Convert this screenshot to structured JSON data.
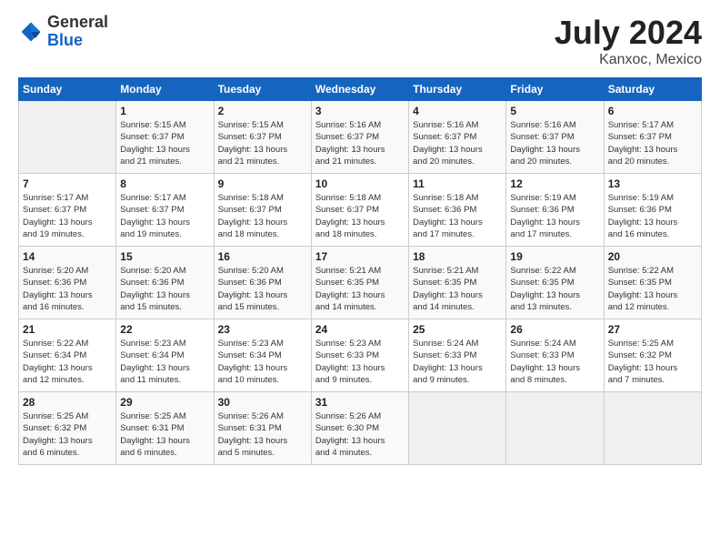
{
  "header": {
    "logo_general": "General",
    "logo_blue": "Blue",
    "title": "July 2024",
    "location": "Kanxoc, Mexico"
  },
  "calendar": {
    "days_of_week": [
      "Sunday",
      "Monday",
      "Tuesday",
      "Wednesday",
      "Thursday",
      "Friday",
      "Saturday"
    ],
    "weeks": [
      [
        {
          "day": "",
          "info": ""
        },
        {
          "day": "1",
          "info": "Sunrise: 5:15 AM\nSunset: 6:37 PM\nDaylight: 13 hours\nand 21 minutes."
        },
        {
          "day": "2",
          "info": "Sunrise: 5:15 AM\nSunset: 6:37 PM\nDaylight: 13 hours\nand 21 minutes."
        },
        {
          "day": "3",
          "info": "Sunrise: 5:16 AM\nSunset: 6:37 PM\nDaylight: 13 hours\nand 21 minutes."
        },
        {
          "day": "4",
          "info": "Sunrise: 5:16 AM\nSunset: 6:37 PM\nDaylight: 13 hours\nand 20 minutes."
        },
        {
          "day": "5",
          "info": "Sunrise: 5:16 AM\nSunset: 6:37 PM\nDaylight: 13 hours\nand 20 minutes."
        },
        {
          "day": "6",
          "info": "Sunrise: 5:17 AM\nSunset: 6:37 PM\nDaylight: 13 hours\nand 20 minutes."
        }
      ],
      [
        {
          "day": "7",
          "info": "Sunrise: 5:17 AM\nSunset: 6:37 PM\nDaylight: 13 hours\nand 19 minutes."
        },
        {
          "day": "8",
          "info": "Sunrise: 5:17 AM\nSunset: 6:37 PM\nDaylight: 13 hours\nand 19 minutes."
        },
        {
          "day": "9",
          "info": "Sunrise: 5:18 AM\nSunset: 6:37 PM\nDaylight: 13 hours\nand 18 minutes."
        },
        {
          "day": "10",
          "info": "Sunrise: 5:18 AM\nSunset: 6:37 PM\nDaylight: 13 hours\nand 18 minutes."
        },
        {
          "day": "11",
          "info": "Sunrise: 5:18 AM\nSunset: 6:36 PM\nDaylight: 13 hours\nand 17 minutes."
        },
        {
          "day": "12",
          "info": "Sunrise: 5:19 AM\nSunset: 6:36 PM\nDaylight: 13 hours\nand 17 minutes."
        },
        {
          "day": "13",
          "info": "Sunrise: 5:19 AM\nSunset: 6:36 PM\nDaylight: 13 hours\nand 16 minutes."
        }
      ],
      [
        {
          "day": "14",
          "info": "Sunrise: 5:20 AM\nSunset: 6:36 PM\nDaylight: 13 hours\nand 16 minutes."
        },
        {
          "day": "15",
          "info": "Sunrise: 5:20 AM\nSunset: 6:36 PM\nDaylight: 13 hours\nand 15 minutes."
        },
        {
          "day": "16",
          "info": "Sunrise: 5:20 AM\nSunset: 6:36 PM\nDaylight: 13 hours\nand 15 minutes."
        },
        {
          "day": "17",
          "info": "Sunrise: 5:21 AM\nSunset: 6:35 PM\nDaylight: 13 hours\nand 14 minutes."
        },
        {
          "day": "18",
          "info": "Sunrise: 5:21 AM\nSunset: 6:35 PM\nDaylight: 13 hours\nand 14 minutes."
        },
        {
          "day": "19",
          "info": "Sunrise: 5:22 AM\nSunset: 6:35 PM\nDaylight: 13 hours\nand 13 minutes."
        },
        {
          "day": "20",
          "info": "Sunrise: 5:22 AM\nSunset: 6:35 PM\nDaylight: 13 hours\nand 12 minutes."
        }
      ],
      [
        {
          "day": "21",
          "info": "Sunrise: 5:22 AM\nSunset: 6:34 PM\nDaylight: 13 hours\nand 12 minutes."
        },
        {
          "day": "22",
          "info": "Sunrise: 5:23 AM\nSunset: 6:34 PM\nDaylight: 13 hours\nand 11 minutes."
        },
        {
          "day": "23",
          "info": "Sunrise: 5:23 AM\nSunset: 6:34 PM\nDaylight: 13 hours\nand 10 minutes."
        },
        {
          "day": "24",
          "info": "Sunrise: 5:23 AM\nSunset: 6:33 PM\nDaylight: 13 hours\nand 9 minutes."
        },
        {
          "day": "25",
          "info": "Sunrise: 5:24 AM\nSunset: 6:33 PM\nDaylight: 13 hours\nand 9 minutes."
        },
        {
          "day": "26",
          "info": "Sunrise: 5:24 AM\nSunset: 6:33 PM\nDaylight: 13 hours\nand 8 minutes."
        },
        {
          "day": "27",
          "info": "Sunrise: 5:25 AM\nSunset: 6:32 PM\nDaylight: 13 hours\nand 7 minutes."
        }
      ],
      [
        {
          "day": "28",
          "info": "Sunrise: 5:25 AM\nSunset: 6:32 PM\nDaylight: 13 hours\nand 6 minutes."
        },
        {
          "day": "29",
          "info": "Sunrise: 5:25 AM\nSunset: 6:31 PM\nDaylight: 13 hours\nand 6 minutes."
        },
        {
          "day": "30",
          "info": "Sunrise: 5:26 AM\nSunset: 6:31 PM\nDaylight: 13 hours\nand 5 minutes."
        },
        {
          "day": "31",
          "info": "Sunrise: 5:26 AM\nSunset: 6:30 PM\nDaylight: 13 hours\nand 4 minutes."
        },
        {
          "day": "",
          "info": ""
        },
        {
          "day": "",
          "info": ""
        },
        {
          "day": "",
          "info": ""
        }
      ]
    ]
  }
}
